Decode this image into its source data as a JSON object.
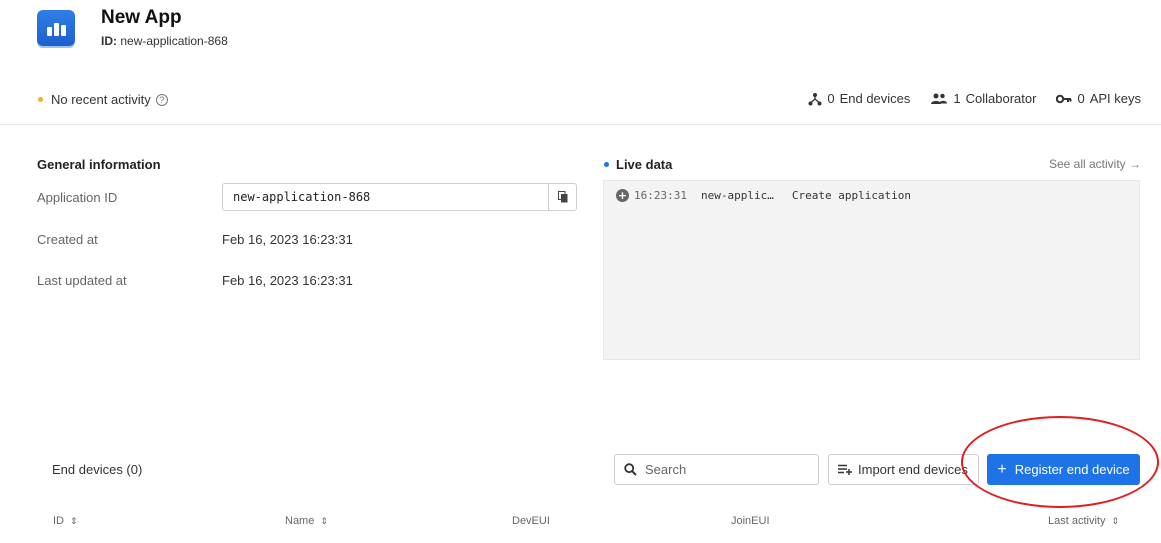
{
  "app": {
    "title": "New App",
    "id_label": "ID:",
    "id_value": "new-application-868",
    "icon": "chart-bars-icon"
  },
  "status": {
    "text": "No recent activity",
    "dot_color": "#f2b129"
  },
  "stats": [
    {
      "icon": "devices-icon",
      "count": "0",
      "label": "End devices"
    },
    {
      "icon": "collaborators-icon",
      "count": "1",
      "label": "Collaborator"
    },
    {
      "icon": "key-icon",
      "count": "0",
      "label": "API keys"
    }
  ],
  "general": {
    "title": "General information",
    "rows": [
      {
        "label": "Application ID",
        "value": "new-application-868"
      },
      {
        "label": "Created at",
        "value": "Feb 16, 2023 16:23:31"
      },
      {
        "label": "Last updated at",
        "value": "Feb 16, 2023 16:23:31"
      }
    ]
  },
  "live": {
    "title": "Live data",
    "see_all": "See all activity →",
    "events": [
      {
        "time": "16:23:31",
        "entity": "new-applic…",
        "description": "Create application"
      }
    ]
  },
  "end_devices": {
    "title": "End devices (0)",
    "search_placeholder": "Search",
    "import_label": "Import end devices",
    "register_label": "Register end device",
    "columns": [
      "ID",
      "Name",
      "DevEUI",
      "JoinEUI",
      "Last activity"
    ]
  },
  "colors": {
    "primary": "#1e73e6",
    "annotation": "#e01e1e"
  }
}
